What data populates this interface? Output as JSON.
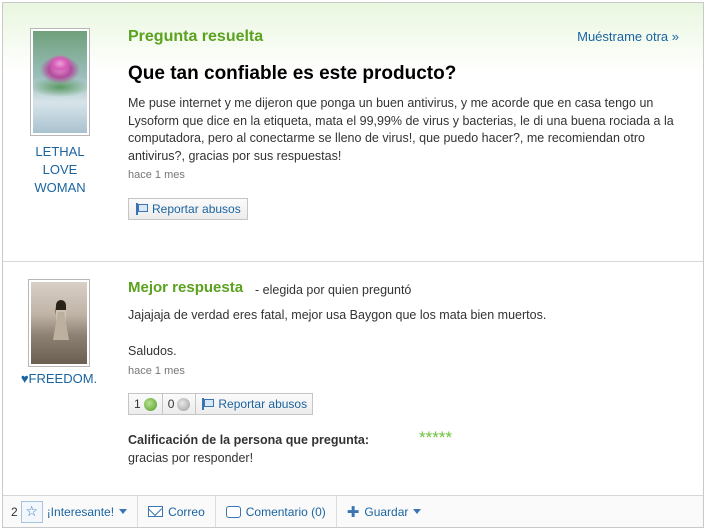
{
  "question_section": {
    "title": "Pregunta resuelta",
    "show_another": "Muéstrame otra »",
    "question_title": "Que tan confiable es este producto?",
    "body": "Me puse internet y me dijeron que ponga un buen antivirus, y me acorde que en casa tengo un Lysoform que dice en la etiqueta, mata el 99,99% de virus y bacterias, le di una buena rociada a la computadora, pero al conectarme se lleno de virus!, que puedo hacer?, me recomiendan otro antivirus?, gracias por sus respuestas!",
    "time": "hace 1 mes",
    "report_label": "Reportar abusos",
    "asker": {
      "name_line1": "LETHAL",
      "name_line2": "LOVE",
      "name_line3": "WOMAN"
    }
  },
  "answer_section": {
    "title": "Mejor respuesta",
    "chosen_note": "- elegida por quien preguntó",
    "body_line1": "Jajajaja de verdad eres fatal, mejor usa Baygon que los mata bien muertos.",
    "body_line2": "Saludos.",
    "time": "hace 1 mes",
    "thumbs_up_count": "1",
    "thumbs_down_count": "0",
    "report_label": "Reportar abusos",
    "answerer": {
      "name": "♥FREEDOM."
    },
    "rating_label": "Calificación de la persona que pregunta:",
    "rating_stars": "*****",
    "rating_comment": "gracias por responder!"
  },
  "bottom_bar": {
    "interesting_count": "2",
    "interesting_label": "¡Interesante!",
    "mail_label": "Correo",
    "comment_label": "Comentario (0)",
    "save_label": "Guardar"
  },
  "colors": {
    "accent_green": "#5ba21f",
    "link_blue": "#1a64a0",
    "star_green": "#6dc23b"
  }
}
